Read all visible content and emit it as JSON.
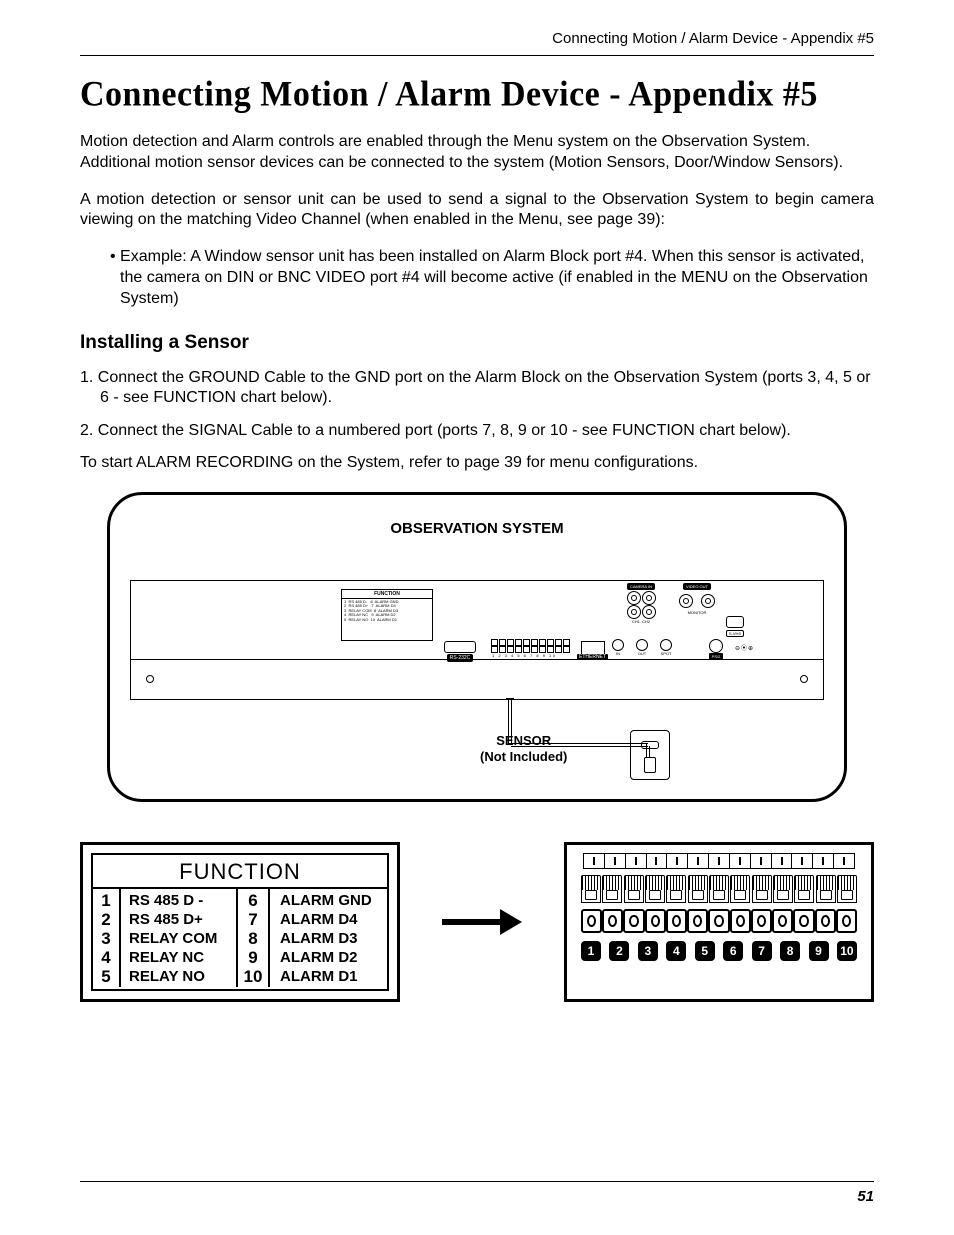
{
  "header": {
    "running": "Connecting Motion / Alarm Device - Appendix #5"
  },
  "title": "Connecting Motion / Alarm Device - Appendix #5",
  "para1": "Motion detection and Alarm controls are enabled through the Menu system on the Observation System. Additional motion sensor devices can be connected to the system (Motion Sensors, Door/Window Sensors).",
  "para2": "A motion detection or sensor unit can be used to send a signal to the Observation System to begin camera viewing on the matching Video Channel (when enabled in the Menu, see page 39):",
  "bullet1": "• Example: A Window sensor unit has been installed on Alarm Block port #4. When this sensor is activated, the camera on DIN or BNC VIDEO port #4 will become active (if enabled in the MENU on the Observation System)",
  "subhead": "Installing a Sensor",
  "step1": "1. Connect the GROUND Cable to the GND port on the Alarm Block on the Observation System (ports 3, 4, 5 or 6 - see FUNCTION chart below).",
  "step2": "2. Connect the SIGNAL Cable to a numbered port (ports 7, 8, 9 or 10 - see FUNCTION chart below).",
  "refline": "To start ALARM RECORDING on the System, refer to page 39 for menu configurations.",
  "diagram1": {
    "title": "OBSERVATION SYSTEM",
    "mini_func_header": "FUNCTION",
    "mini_func_lines": "1  RS 485 D-   6  ALARM GND\n2  RS 485 D+   7  ALARM D4\n3  RELAY COM  8  ALARM D3\n4  RELAY NC   9  ALARM D2\n5  RELAY NO  10  ALARM D1",
    "rs232": "RS-232C",
    "terminal_nums": "1 2 3 4 5 6 7 8 9 10",
    "ethernet": "ETHERNET",
    "camera_in": "CAMERA IN",
    "video_out": "VIDEO OUT",
    "monitor": "MONITOR",
    "svhs": "S-VHS",
    "audio_in": "IN",
    "audio_out": "OUT",
    "spot": "SPOT",
    "ps2": "PS/2",
    "sensor_label_1": "SENSOR",
    "sensor_label_2": "(Not Included)"
  },
  "function_chart": {
    "title": "FUNCTION",
    "left_nums": [
      "1",
      "2",
      "3",
      "4",
      "5"
    ],
    "left_labels": [
      "RS 485 D -",
      "RS 485 D+",
      "RELAY COM",
      "RELAY NC",
      "RELAY NO"
    ],
    "right_nums": [
      "6",
      "7",
      "8",
      "9",
      "10"
    ],
    "right_labels": [
      "ALARM GND",
      "ALARM D4",
      "ALARM D3",
      "ALARM D2",
      "ALARM D1"
    ]
  },
  "terminal_block": {
    "numbers": [
      "1",
      "2",
      "3",
      "4",
      "5",
      "6",
      "7",
      "8",
      "9",
      "10"
    ]
  },
  "page_number": "51"
}
